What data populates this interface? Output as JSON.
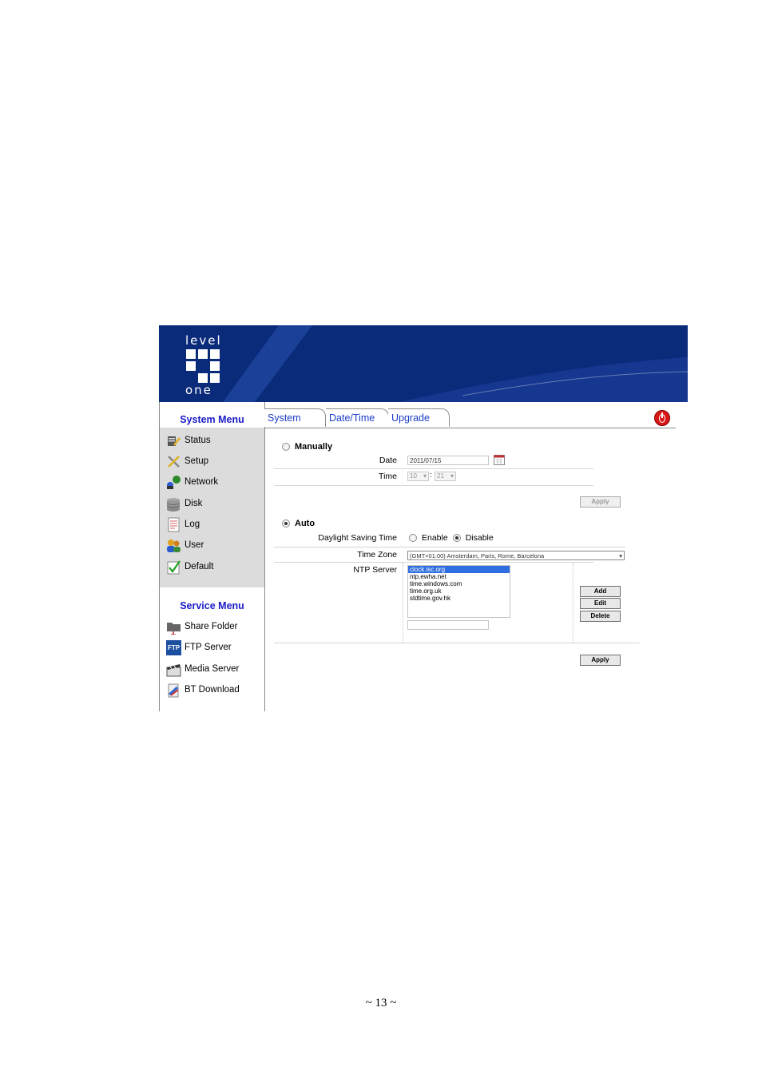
{
  "header": {
    "logo_top": "level",
    "logo_bottom": "one"
  },
  "system_menu": {
    "title": "System Menu",
    "items": [
      {
        "label": "Status",
        "icon": "status-icon"
      },
      {
        "label": "Setup",
        "icon": "setup-icon"
      },
      {
        "label": "Network",
        "icon": "network-icon"
      },
      {
        "label": "Disk",
        "icon": "disk-icon"
      },
      {
        "label": "Log",
        "icon": "log-icon"
      },
      {
        "label": "User",
        "icon": "user-icon"
      },
      {
        "label": "Default",
        "icon": "default-icon"
      }
    ]
  },
  "service_menu": {
    "title": "Service Menu",
    "items": [
      {
        "label": "Share Folder",
        "icon": "share-folder-icon"
      },
      {
        "label": "FTP Server",
        "icon": "ftp-icon",
        "icon_text": "FTP"
      },
      {
        "label": "Media Server",
        "icon": "media-icon"
      },
      {
        "label": "BT Download",
        "icon": "bt-download-icon"
      }
    ]
  },
  "tabs": [
    "System",
    "Date/Time",
    "Upgrade"
  ],
  "manually": {
    "label": "Manually",
    "selected": false,
    "date_label": "Date",
    "date_value": "2011/07/15",
    "time_label": "Time",
    "hour": "10",
    "minute": "21",
    "separator": ":",
    "apply": "Apply"
  },
  "auto": {
    "label": "Auto",
    "selected": true,
    "dst_label": "Daylight Saving Time",
    "dst_enable": "Enable",
    "dst_disable": "Disable",
    "dst_selected": "Disable",
    "tz_label": "Time Zone",
    "tz_value": "(GMT+01:00) Amsterdam, Paris, Rome, Barcelona",
    "ntp_label": "NTP Server",
    "ntp_servers": [
      "clock.isc.org",
      "ntp.ewha.net",
      "time.windows.com",
      "time.org.uk",
      "stdtime.gov.hk"
    ],
    "ntp_selected": "clock.isc.org",
    "add": "Add",
    "edit": "Edit",
    "delete": "Delete",
    "apply": "Apply"
  },
  "page_number": "~ 13 ~",
  "colors": {
    "banner": "#0a2a7a",
    "menu_title": "#1a1ac8",
    "tab_text": "#1a3cc8",
    "sidebar_bg": "#dcdcdc"
  }
}
